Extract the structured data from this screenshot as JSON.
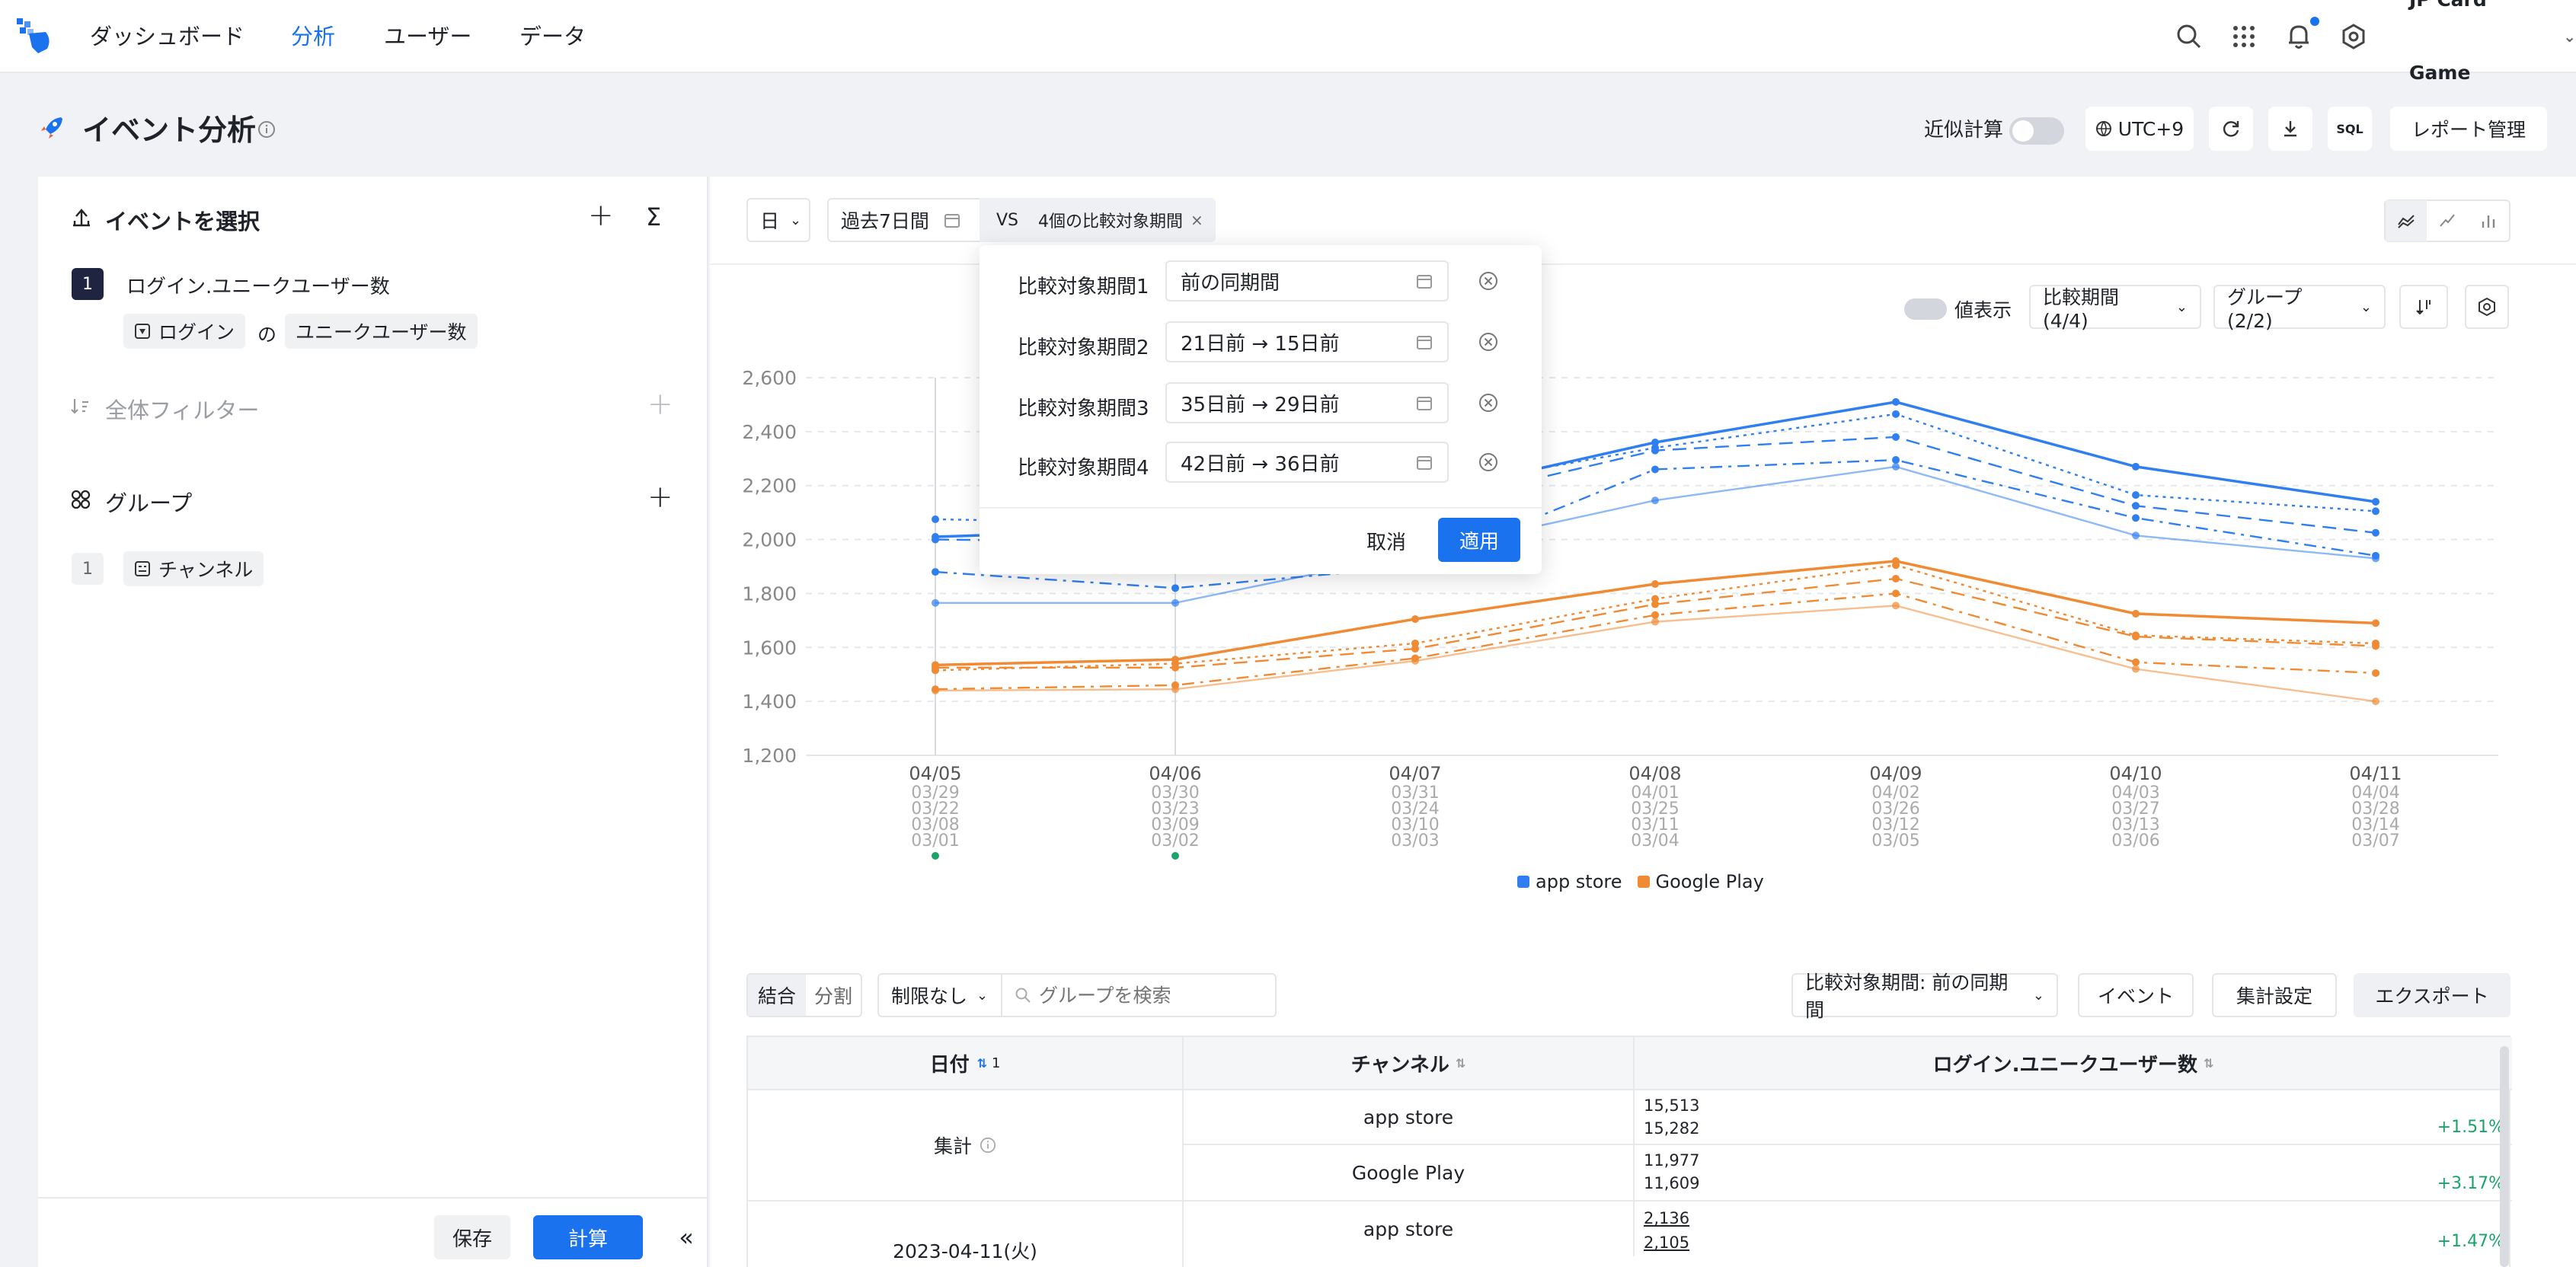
{
  "nav": {
    "items": [
      {
        "label": "ダッシュボード"
      },
      {
        "label": "分析"
      },
      {
        "label": "ユーザー"
      },
      {
        "label": "データ"
      }
    ],
    "project": "JP Card Game",
    "accent": "#1b72ee"
  },
  "header": {
    "title": "イベント分析",
    "approx_label": "近似計算",
    "approx_enabled": false,
    "timezone": "UTC+9",
    "sql_label": "SQL",
    "report_label": "レポート管理"
  },
  "left": {
    "events_title": "イベントを選択",
    "event1": {
      "index": "1",
      "name": "ログイン.ユニークユーザー数",
      "event_chip": "ログイン",
      "of": "の",
      "metric_chip": "ユニークユーザー数"
    },
    "filter_title": "全体フィルター",
    "group_title": "グループ",
    "group1": {
      "index": "1",
      "chip": "チャンネル"
    },
    "save_label": "保存",
    "compute_label": "計算"
  },
  "toolbar": {
    "granularity": "日",
    "range": "過去7日間",
    "vs_label": "VS",
    "compare_chip": "4個の比較対象期間"
  },
  "popover": {
    "rows": [
      {
        "label": "比較対象期間1",
        "value": "前の同期間"
      },
      {
        "label": "比較対象期間2",
        "value": "21日前 → 15日前"
      },
      {
        "label": "比較対象期間3",
        "value": "35日前 → 29日前"
      },
      {
        "label": "比較対象期間4",
        "value": "42日前 → 36日前"
      }
    ],
    "cancel_label": "取消",
    "apply_label": "適用"
  },
  "chart_controls": {
    "show_values_label": "値表示",
    "compare_dropdown": "比較期間 (4/4)",
    "group_dropdown": "グループ (2/2)"
  },
  "chart_data": {
    "type": "line",
    "x": [
      "04/05",
      "04/06",
      "04/07",
      "04/08",
      "04/09",
      "04/10",
      "04/11"
    ],
    "x_compare": [
      [
        "03/29",
        "03/30",
        "03/31",
        "04/01",
        "04/02",
        "04/03",
        "04/04"
      ],
      [
        "03/22",
        "03/23",
        "03/24",
        "03/25",
        "03/26",
        "03/27",
        "03/28"
      ],
      [
        "03/08",
        "03/09",
        "03/10",
        "03/11",
        "03/12",
        "03/13",
        "03/14"
      ],
      [
        "03/01",
        "03/02",
        "03/03",
        "03/04",
        "03/05",
        "03/06",
        "03/07"
      ]
    ],
    "ylim": [
      1200,
      2600
    ],
    "yticks": [
      1200,
      1400,
      1600,
      1800,
      2000,
      2200,
      2400,
      2600
    ],
    "grid": true,
    "legend": [
      {
        "name": "app store",
        "color": "#2f7ff0"
      },
      {
        "name": "Google Play",
        "color": "#f08a33"
      }
    ],
    "series": [
      {
        "name": "app store",
        "group": 0,
        "dash": "solid",
        "values": [
          2010,
          2040,
          2160,
          2360,
          2510,
          2270,
          2140
        ]
      },
      {
        "name": "app store",
        "group": 0,
        "dash": "dot",
        "values": [
          2075,
          2060,
          2180,
          2340,
          2465,
          2165,
          2105
        ]
      },
      {
        "name": "app store",
        "group": 0,
        "dash": "dash",
        "values": [
          2000,
          1990,
          2120,
          2330,
          2380,
          2125,
          2025
        ]
      },
      {
        "name": "app store",
        "group": 0,
        "dash": "dashdot",
        "values": [
          1880,
          1820,
          1900,
          2260,
          2295,
          2080,
          1940
        ]
      },
      {
        "name": "app store",
        "group": 0,
        "dash": "light",
        "values": [
          1765,
          1765,
          1950,
          2145,
          2270,
          2015,
          1930
        ]
      },
      {
        "name": "Google Play",
        "group": 1,
        "dash": "solid",
        "values": [
          1535,
          1555,
          1705,
          1835,
          1920,
          1725,
          1690
        ]
      },
      {
        "name": "Google Play",
        "group": 1,
        "dash": "dot",
        "values": [
          1515,
          1540,
          1615,
          1780,
          1905,
          1645,
          1615
        ]
      },
      {
        "name": "Google Play",
        "group": 1,
        "dash": "dash",
        "values": [
          1525,
          1525,
          1595,
          1760,
          1855,
          1640,
          1605
        ]
      },
      {
        "name": "Google Play",
        "group": 1,
        "dash": "dashdot",
        "values": [
          1445,
          1460,
          1560,
          1720,
          1800,
          1545,
          1505
        ]
      },
      {
        "name": "Google Play",
        "group": 1,
        "dash": "light",
        "values": [
          1440,
          1445,
          1550,
          1695,
          1755,
          1520,
          1400
        ]
      }
    ],
    "annotations": [
      "04/05",
      "04/06"
    ]
  },
  "table_controls": {
    "tab_merge": "結合",
    "tab_split": "分割",
    "limit": "制限なし",
    "search_placeholder": "グループを検索",
    "compare_select": "比較対象期間: 前の同期間",
    "event_btn": "イベント",
    "agg_btn": "集計設定",
    "export_btn": "エクスポート"
  },
  "table": {
    "headers": {
      "date": "日付",
      "date_sort_badge": "1",
      "channel": "チャンネル",
      "metric": "ログイン.ユニークユーザー数"
    },
    "summary_label": "集計",
    "rows": [
      {
        "channel": "app store",
        "v1": "15,513",
        "v2": "15,282",
        "pct": "+1.51%"
      },
      {
        "channel": "Google Play",
        "v1": "11,977",
        "v2": "11,609",
        "pct": "+3.17%"
      },
      {
        "date": "2023-04-11(火)",
        "channel": "app store",
        "v1": "2,136",
        "v2": "2,105",
        "pct": "+1.47%"
      }
    ]
  }
}
